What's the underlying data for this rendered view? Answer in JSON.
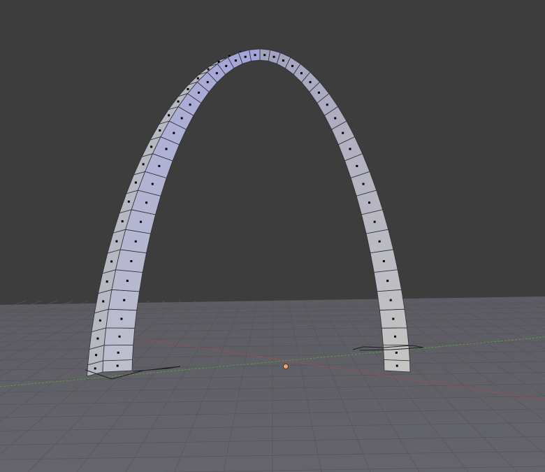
{
  "viewport": {
    "background_color": "#3d3d3d",
    "ground_color": "#606066",
    "grid_line_color": "#55555b",
    "x_axis_color": "#b04a4a",
    "y_axis_color": "#5a9a4a"
  },
  "scene": {
    "object": "arch-mesh",
    "mode": "edit-mode",
    "selection": "vertices",
    "show_grid": true,
    "show_axes": true,
    "mesh_face_color": "#b4b7c7",
    "mesh_edge_color": "#2f2f36",
    "vertex_color": "#000000",
    "origin_color": "#e9a46b"
  }
}
